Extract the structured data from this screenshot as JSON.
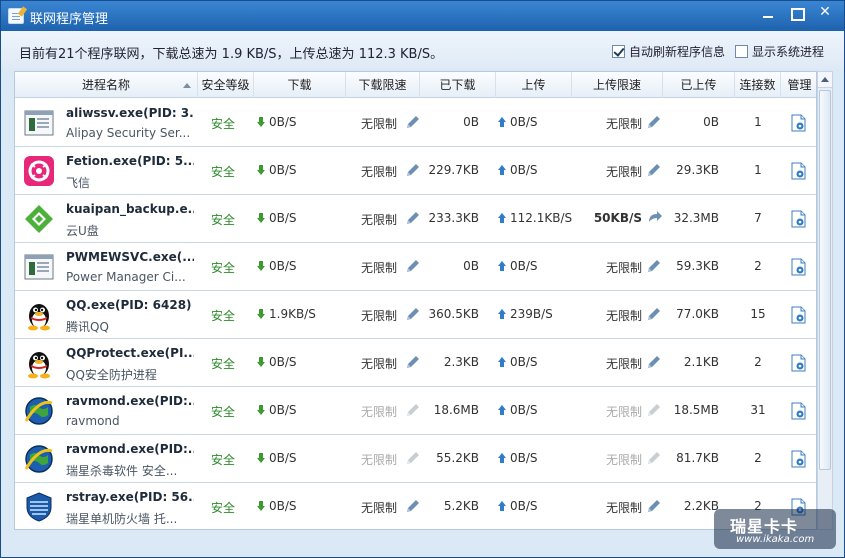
{
  "window": {
    "title": "联网程序管理"
  },
  "summary": {
    "text": "目前有21个程序联网，下载总速为  1.9 KB/S，上传总速为  112.3 KB/S。",
    "auto_refresh_label": "自动刷新程序信息",
    "auto_refresh_checked": true,
    "show_system_label": "显示系统进程",
    "show_system_checked": false
  },
  "columns": [
    "进程名称",
    "安全等级",
    "下载",
    "下载限速",
    "已下载",
    "上传",
    "上传限速",
    "已上传",
    "连接数",
    "管理"
  ],
  "rows": [
    {
      "icon": "window-app-icon",
      "name": "aliwssv.exe(PID: 3...",
      "desc": "Alipay Security Ser...",
      "safety": "安全",
      "download": "0B/S",
      "download_limit": "无限制",
      "downloaded": "0B",
      "upload": "0B/S",
      "upload_limit": "无限制",
      "uploaded": "0B",
      "connections": "1",
      "muted": false,
      "upload_limit_bold": false
    },
    {
      "icon": "fetion-icon",
      "name": "Fetion.exe(PID: 5...",
      "desc": "飞信",
      "safety": "安全",
      "download": "0B/S",
      "download_limit": "无限制",
      "downloaded": "229.7KB",
      "upload": "0B/S",
      "upload_limit": "无限制",
      "uploaded": "29.3KB",
      "connections": "1",
      "muted": false,
      "upload_limit_bold": false
    },
    {
      "icon": "kuaipan-icon",
      "name": "kuaipan_backup.e...",
      "desc": "云U盘",
      "safety": "安全",
      "download": "0B/S",
      "download_limit": "无限制",
      "downloaded": "233.3KB",
      "upload": "112.1KB/S",
      "upload_limit": "50KB/S",
      "uploaded": "32.3MB",
      "connections": "7",
      "muted": false,
      "upload_limit_bold": true
    },
    {
      "icon": "window-app-icon",
      "name": "PWMEWSVC.exe(...",
      "desc": "Power Manager Ci...",
      "safety": "安全",
      "download": "0B/S",
      "download_limit": "无限制",
      "downloaded": "0B",
      "upload": "0B/S",
      "upload_limit": "无限制",
      "uploaded": "59.3KB",
      "connections": "2",
      "muted": false,
      "upload_limit_bold": false
    },
    {
      "icon": "qq-penguin-icon",
      "name": "QQ.exe(PID: 6428)",
      "desc": "腾讯QQ",
      "safety": "安全",
      "download": "1.9KB/S",
      "download_limit": "无限制",
      "downloaded": "360.5KB",
      "upload": "239B/S",
      "upload_limit": "无限制",
      "uploaded": "77.0KB",
      "connections": "15",
      "muted": false,
      "upload_limit_bold": false
    },
    {
      "icon": "qq-penguin-icon",
      "name": "QQProtect.exe(PI...",
      "desc": "QQ安全防护进程",
      "safety": "安全",
      "download": "0B/S",
      "download_limit": "无限制",
      "downloaded": "2.3KB",
      "upload": "0B/S",
      "upload_limit": "无限制",
      "uploaded": "2.1KB",
      "connections": "2",
      "muted": false,
      "upload_limit_bold": false
    },
    {
      "icon": "rising-globe-icon",
      "name": "ravmond.exe(PID:...",
      "desc": "ravmond",
      "safety": "安全",
      "download": "0B/S",
      "download_limit": "无限制",
      "downloaded": "18.6MB",
      "upload": "0B/S",
      "upload_limit": "无限制",
      "uploaded": "18.5MB",
      "connections": "31",
      "muted": true,
      "upload_limit_bold": false
    },
    {
      "icon": "rising-globe-icon",
      "name": "ravmond.exe(PID:...",
      "desc": "瑞星杀毒软件 安全...",
      "safety": "安全",
      "download": "0B/S",
      "download_limit": "无限制",
      "downloaded": "55.2KB",
      "upload": "0B/S",
      "upload_limit": "无限制",
      "uploaded": "81.7KB",
      "connections": "2",
      "muted": true,
      "upload_limit_bold": false
    },
    {
      "icon": "rising-shield-icon",
      "name": "rstray.exe(PID: 56...",
      "desc": "瑞星单机防火墙  托...",
      "safety": "安全",
      "download": "0B/S",
      "download_limit": "无限制",
      "downloaded": "5.2KB",
      "upload": "0B/S",
      "upload_limit": "无限制",
      "uploaded": "2.2KB",
      "connections": "2",
      "muted": false,
      "upload_limit_bold": false
    }
  ],
  "watermark": {
    "main": "瑞星卡卡",
    "sub": "www.ikaka.com"
  },
  "colors": {
    "titlebar": "#1e62ae",
    "safe": "#2d8a2d",
    "download_arrow": "#3d9b2e",
    "upload_arrow": "#2f7cc9"
  }
}
